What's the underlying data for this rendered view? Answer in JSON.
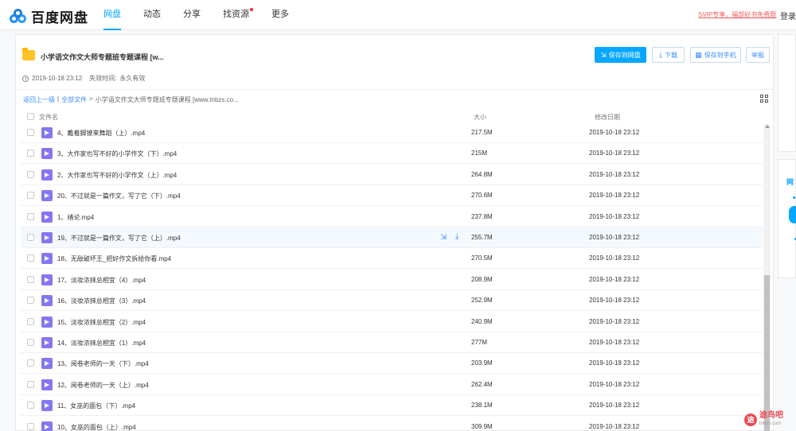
{
  "app": {
    "logo_text": "百度网盘",
    "nav": [
      {
        "label": "网盘",
        "active": true
      },
      {
        "label": "动态",
        "active": false
      },
      {
        "label": "分享",
        "active": false
      },
      {
        "label": "找资源",
        "active": false,
        "badge_dot": true
      },
      {
        "label": "更多",
        "active": false
      }
    ],
    "vip_promo": "SVIP专享，福部好书免费题",
    "login": "登录"
  },
  "share": {
    "title": "小学语文作文大师专题班专题课程 [w...",
    "created": "2019-10-18 23:12",
    "expiry_label": "失效时间:",
    "expiry_value": "永久有效",
    "buttons": {
      "save_to_netdisk": "保存到网盘",
      "download": "下载",
      "save_to_phone": "保存到手机",
      "report": "举报"
    }
  },
  "breadcrumb": {
    "back": "返回上一级",
    "separator": "|",
    "all_files": "全部文件",
    "arrow": ">",
    "current": "小学语文作文大师专题班专题课程 [www.tnbzs.co..."
  },
  "table": {
    "columns": {
      "name": "文件名",
      "size": "大小",
      "date": "修改日期"
    },
    "rows": [
      {
        "name": "4、戴着脚镣来舞蹈（上）.mp4",
        "size": "217.5M",
        "date": "2019-10-18 23:12"
      },
      {
        "name": "3、大作家也写不好的小学作文（下）.mp4",
        "size": "215M",
        "date": "2019-10-18 23:12"
      },
      {
        "name": "2、大作家也写不好的小学作文（上）.mp4",
        "size": "264.8M",
        "date": "2019-10-18 23:12"
      },
      {
        "name": "20、不过就是一篇作文，写了它（下）.mp4",
        "size": "270.6M",
        "date": "2019-10-18 23:12"
      },
      {
        "name": "1、绪论.mp4",
        "size": "237.8M",
        "date": "2019-10-18 23:12"
      },
      {
        "name": "19、不过就是一篇作文，写了它（上）.mp4",
        "size": "255.7M",
        "date": "2019-10-18 23:12",
        "hover": true
      },
      {
        "name": "18、无敌破坏王_把好作文拆给你看.mp4",
        "size": "270.5M",
        "date": "2019-10-18 23:12"
      },
      {
        "name": "17、淡妆浓抹总相宜（4）.mp4",
        "size": "208.9M",
        "date": "2019-10-18 23:12"
      },
      {
        "name": "16、淡妆浓抹总相宜（3）.mp4",
        "size": "252.9M",
        "date": "2019-10-18 23:12"
      },
      {
        "name": "15、淡妆浓抹总相宜（2）.mp4",
        "size": "240.9M",
        "date": "2019-10-18 23:12"
      },
      {
        "name": "14、淡妆浓抹总相宜（1）.mp4",
        "size": "277M",
        "date": "2019-10-18 23:12"
      },
      {
        "name": "13、阅卷老师的一天（下）.mp4",
        "size": "203.9M",
        "date": "2019-10-18 23:12"
      },
      {
        "name": "12、阅卷老师的一天（上）.mp4",
        "size": "262.4M",
        "date": "2019-10-18 23:12"
      },
      {
        "name": "11、女巫的面包（下）.mp4",
        "size": "238.1M",
        "date": "2019-10-18 23:12"
      },
      {
        "name": "10、女巫的面包（上）.mp4",
        "size": "309.9M",
        "date": "2019-10-18 23:12"
      }
    ]
  },
  "sidebar": {
    "label": "网"
  },
  "watermark": {
    "logo": "途",
    "text": "途鸟吧",
    "sub": "tnbzs.com"
  },
  "colors": {
    "accent": "#06a7ff",
    "video_icon": "#8477f0",
    "folder": "#ffc22a",
    "promo": "#f25a5a"
  }
}
